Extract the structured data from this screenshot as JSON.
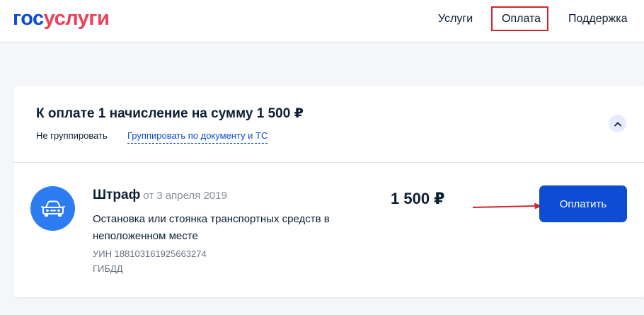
{
  "header": {
    "logo_part1": "гос",
    "logo_part2": "услуги",
    "nav": [
      {
        "label": "Услуги"
      },
      {
        "label": "Оплата",
        "highlighted": true
      },
      {
        "label": "Поддержка"
      }
    ]
  },
  "summary": {
    "title": "К оплате 1 начисление на сумму 1 500 ₽",
    "group_off": "Не группировать",
    "group_by_doc": "Группировать по документу и ТС",
    "collapse_icon": "chevron-up-icon"
  },
  "charge": {
    "icon": "car-icon",
    "type": "Штраф",
    "date": "от 3 апреля 2019",
    "description": "Остановка или стоянка транспортных средств в неположенном месте",
    "uin": "УИН 188103161925663274",
    "organization": "ГИБДД",
    "amount": "1 500 ₽",
    "pay_label": "Оплатить"
  },
  "colors": {
    "brand_blue": "#0d4cd3",
    "brand_red": "#ee3f58",
    "annotation_red": "#d0262f",
    "icon_blue": "#2d7cf2"
  }
}
